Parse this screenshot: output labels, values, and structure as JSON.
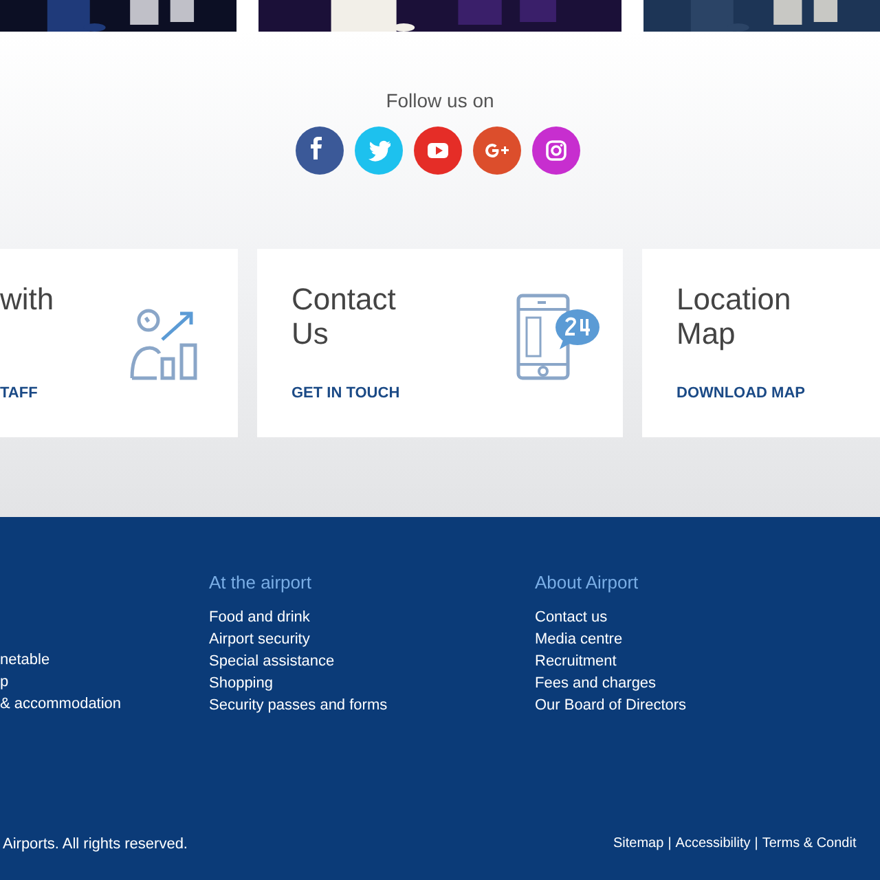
{
  "social": {
    "heading": "Follow us on",
    "icons": [
      {
        "kind": "facebook",
        "color": "#3b5998"
      },
      {
        "kind": "twitter",
        "color": "#1dc1ee"
      },
      {
        "kind": "youtube",
        "color": "#e52d27"
      },
      {
        "kind": "googleplus",
        "color": "#dc4e2c"
      },
      {
        "kind": "instagram",
        "color": "#c72ecf"
      }
    ]
  },
  "cards": [
    {
      "title": "with",
      "link": "TAFF",
      "kind": "staff"
    },
    {
      "title": "Contact Us",
      "link": "GET IN TOUCH",
      "kind": "call"
    },
    {
      "title": "Location Map",
      "link": "DOWNLOAD MAP",
      "kind": "plain"
    }
  ],
  "footer": {
    "columns": [
      {
        "items": [
          "netable",
          "p",
          "& accommodation"
        ]
      },
      {
        "heading": "At the airport",
        "items": [
          "Food and drink",
          "Airport security",
          "Special assistance",
          "Shopping",
          "Security passes and forms"
        ]
      },
      {
        "heading": "About Airport",
        "items": [
          "Contact us",
          "Media centre",
          "Recruitment",
          "Fees and charges",
          "Our Board of Directors"
        ]
      }
    ],
    "copyright": "Airports. All rights reserved.",
    "links": [
      {
        "text": "Sitemap"
      },
      {
        "separator": "|",
        "text": "Accessibility"
      },
      {
        "separator": "|",
        "text": "Terms & Condit"
      }
    ]
  }
}
